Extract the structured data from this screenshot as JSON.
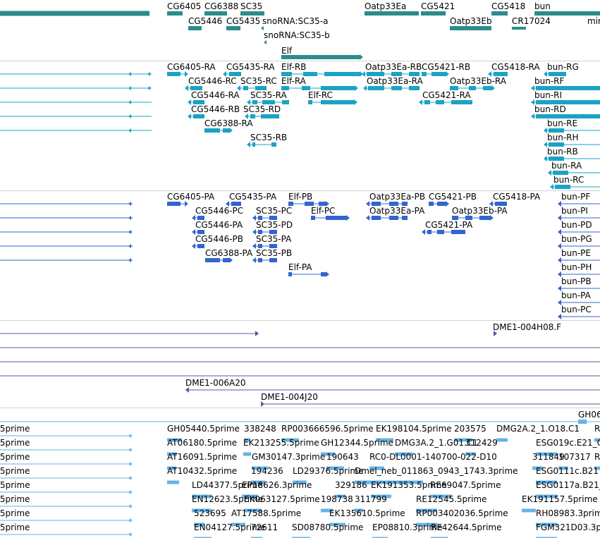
{
  "colors": {
    "gene": "#2c8c8c",
    "transcript": "#1aa3c4",
    "protein": "#3366cc",
    "bac": "#6f4aa3",
    "est": "#66b3e6",
    "separator": "#d2d2d2",
    "text": "#000000"
  },
  "tracks": {
    "genes": {
      "row1": [
        "CG6405",
        "CG6388",
        "SC35",
        "Oatp33Ea",
        "CG5421",
        "CG5418",
        "bun"
      ],
      "row2": [
        "CG5446",
        "CG5435",
        "snoRNA:SC35-a",
        "Oatp33Eb",
        "CR17024",
        "mir"
      ],
      "row3": [
        "snoRNA:SC35-b"
      ],
      "row4": [
        "Elf"
      ]
    },
    "transcripts": {
      "r1": [
        "CG6405-RA",
        "CG5435-RA",
        "Elf-RB",
        "Oatp33Ea-RB",
        "CG5421-RB",
        "CG5418-RA",
        "bun-RG"
      ],
      "r2": [
        "CG5446-RC",
        "SC35-RC",
        "Elf-RA",
        "Oatp33Ea-RA",
        "Oatp33Eb-RA",
        "bun-RF"
      ],
      "r3": [
        "CG5446-RA",
        "SC35-RA",
        "Elf-RC",
        "CG5421-RA",
        "bun-RI"
      ],
      "r4": [
        "CG5446-RB",
        "SC35-RD",
        "bun-RD"
      ],
      "r5": [
        "CG6388-RA",
        "bun-RE"
      ],
      "r6": [
        "SC35-RB",
        "bun-RH"
      ],
      "r7": [
        "bun-RB"
      ],
      "r8": [
        "bun-RA"
      ],
      "r9": [
        "bun-RC"
      ]
    },
    "proteins": {
      "r1": [
        "CG6405-PA",
        "CG5435-PA",
        "Elf-PB",
        "Oatp33Ea-PB",
        "CG5421-PB",
        "CG5418-PA",
        "bun-PF"
      ],
      "r2": [
        "CG5446-PC",
        "SC35-PC",
        "Elf-PC",
        "Oatp33Ea-PA",
        "Oatp33Eb-PA",
        "bun-PI"
      ],
      "r3": [
        "CG5446-PA",
        "SC35-PD",
        "CG5421-PA",
        "bun-PD"
      ],
      "r4": [
        "CG5446-PB",
        "SC35-PA",
        "bun-PG"
      ],
      "r5": [
        "CG6388-PA",
        "SC35-PB",
        "bun-PE"
      ],
      "r6": [
        "Elf-PA",
        "bun-PH"
      ],
      "r7": [
        "bun-PB"
      ],
      "r8": [
        "bun-PA"
      ],
      "r9": [
        "bun-PC"
      ]
    },
    "bacs": [
      "DME1-004H08.F",
      "DME1-006A20",
      "DME1-004J20"
    ],
    "ests": {
      "r0": [
        "GH06"
      ],
      "r1": [
        ".5prime",
        "GH05440.5prime",
        "338248",
        "RP003666596.5prime",
        "EK198104.5prime",
        "203575",
        "DMG2A.2_1.O18.C1",
        "R"
      ],
      "r2": [
        ".5prime",
        "AT06180.5prime",
        "EK213255.5prime",
        "GH12344.5prime",
        "DMG3A.2_1.G01.C1",
        "312429",
        "ESG019c.E21_C"
      ],
      "r3": [
        ".5prime",
        "AT16091.5prime",
        "GM30147.3prime",
        "190643",
        "RC0-DL0001-140700-022-D10",
        "311849",
        "107317",
        "R"
      ],
      "r4": [
        ".5prime",
        "AT10432.5prime",
        "194236",
        "LD29376.5prime",
        "Dmel_neb_011863_0943_1743.3prime",
        "ESG0111c.B21"
      ],
      "r5": [
        "5prime",
        "LD44377.5prime",
        "EP18626.3prime",
        "329186",
        "EK191353.5prime",
        "RE69047.5prime",
        "ESG0117a.B21_"
      ],
      "r6": [
        ".5prime",
        "EN12623.5prime",
        "EK063127.5prime",
        "198738",
        "311799",
        "RE12545.5prime",
        "EK191157.5prime"
      ],
      "r7": [
        ".5prime",
        "523695",
        "AT17588.5prime",
        "EK135610.5prime",
        "RP003402036.5prime",
        "RH08983.3prime"
      ],
      "r8": [
        ".5prime",
        "EN04127.5prime",
        "72611",
        "SD08780.5prime",
        "EP08810.3prime",
        "RE42644.5prime",
        "FGM321D03.3p"
      ]
    }
  }
}
